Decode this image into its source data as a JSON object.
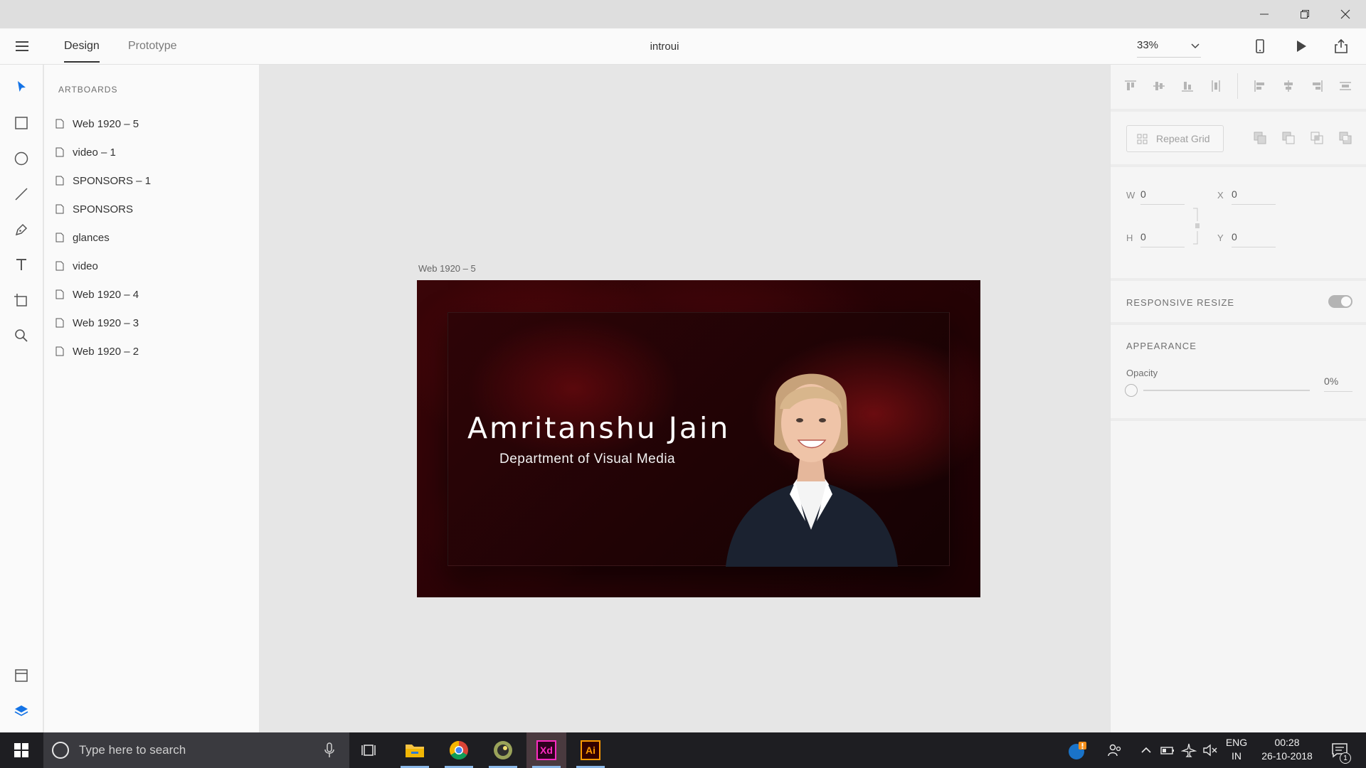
{
  "window": {
    "controls": [
      "minimize",
      "restore",
      "close"
    ]
  },
  "header": {
    "tabs": [
      {
        "label": "Design",
        "active": true
      },
      {
        "label": "Prototype",
        "active": false
      }
    ],
    "document_title": "introui",
    "zoom": "33%"
  },
  "toolbar": {
    "tools": [
      "select-icon",
      "rectangle-icon",
      "ellipse-icon",
      "line-icon",
      "pen-icon",
      "text-icon",
      "artboard-icon",
      "zoom-icon"
    ],
    "bottom_tools": [
      "assets-icon",
      "layers-icon"
    ]
  },
  "layers": {
    "heading": "ARTBOARDS",
    "items": [
      {
        "label": "Web 1920 – 5"
      },
      {
        "label": "video – 1"
      },
      {
        "label": "SPONSORS – 1"
      },
      {
        "label": "SPONSORS"
      },
      {
        "label": "glances"
      },
      {
        "label": "video"
      },
      {
        "label": "Web 1920 – 4"
      },
      {
        "label": "Web 1920 – 3"
      },
      {
        "label": "Web 1920 – 2"
      }
    ]
  },
  "canvas": {
    "artboard_label": "Web 1920 – 5",
    "artboard": {
      "name": "Amritanshu Jain",
      "department": "Department of Visual Media"
    }
  },
  "inspector": {
    "repeat_grid_label": "Repeat Grid",
    "fields": {
      "w_label": "W",
      "w_value": "0",
      "h_label": "H",
      "h_value": "0",
      "x_label": "X",
      "x_value": "0",
      "y_label": "Y",
      "y_value": "0"
    },
    "responsive_resize_label": "RESPONSIVE RESIZE",
    "responsive_resize_on": true,
    "appearance_label": "APPEARANCE",
    "opacity_label": "Opacity",
    "opacity_value": "0%",
    "opacity_fraction": 0
  },
  "taskbar": {
    "search_placeholder": "Type here to search",
    "apps": [
      "file-explorer-icon",
      "chrome-icon",
      "game-app-icon",
      "adobe-xd-icon",
      "adobe-illustrator-icon"
    ],
    "xd_label": "Xd",
    "ai_label": "Ai",
    "language_line1": "ENG",
    "language_line2": "IN",
    "time": "00:28",
    "date": "26-10-2018",
    "notification_count": "1"
  },
  "colors": {
    "accent": "#1473e6",
    "xd_brand": "#ff2bc2",
    "ai_brand": "#ff9a00",
    "artboard_bg": "#2a0306"
  }
}
